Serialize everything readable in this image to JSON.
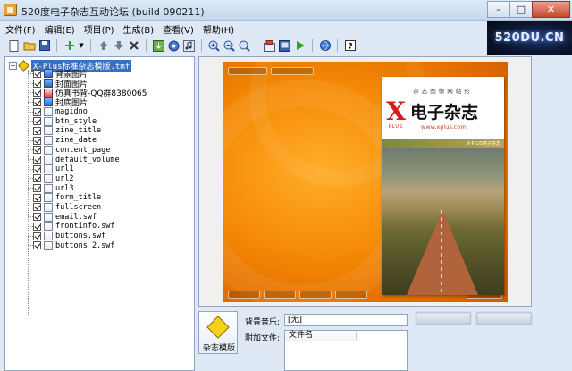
{
  "window": {
    "title": "520度电子杂志互动论坛 (build 090211)",
    "minimize": "–",
    "maximize": "□",
    "close": "✕"
  },
  "logo": {
    "text": "520DU.CN"
  },
  "menu": [
    "文件(F)",
    "编辑(E)",
    "项目(P)",
    "生成(B)",
    "查看(V)",
    "帮助(H)"
  ],
  "toolbar": {
    "icons": [
      "new-file-icon",
      "open-folder-icon",
      "save-icon",
      "add-icon",
      "move-up-icon",
      "move-down-icon",
      "delete-icon",
      "import-icon",
      "settings-icon",
      "music-icon",
      "zoom-in-icon",
      "zoom-out-icon",
      "zoom-reset-icon",
      "build-icon",
      "export-icon",
      "play-icon",
      "globe-icon",
      "help-icon"
    ]
  },
  "tree": {
    "root_label": "X-Plus标准杂志模版.tmf",
    "items": [
      {
        "label": "背景图片",
        "icon": "img"
      },
      {
        "label": "封面图片",
        "icon": "img"
      },
      {
        "label": "仿真书背-QQ群8380065",
        "icon": "img2"
      },
      {
        "label": "封底图片",
        "icon": "img"
      },
      {
        "label": "magidno",
        "icon": "doc"
      },
      {
        "label": "btn_style",
        "icon": "doc"
      },
      {
        "label": "zine_title",
        "icon": "doc"
      },
      {
        "label": "zine_date",
        "icon": "doc"
      },
      {
        "label": "content_page",
        "icon": "doc"
      },
      {
        "label": "default_volume",
        "icon": "doc"
      },
      {
        "label": "url1",
        "icon": "doc"
      },
      {
        "label": "url2",
        "icon": "doc"
      },
      {
        "label": "url3",
        "icon": "doc"
      },
      {
        "label": "form_title",
        "icon": "doc"
      },
      {
        "label": "fullscreen",
        "icon": "doc"
      },
      {
        "label": "email.swf",
        "icon": "doc"
      },
      {
        "label": "frontinfo.swf",
        "icon": "doc"
      },
      {
        "label": "buttons.swf",
        "icon": "doc"
      },
      {
        "label": "buttons_2.swf",
        "icon": "doc"
      }
    ]
  },
  "preview": {
    "cover_tagline": "杂志图像网站形",
    "cover_title": "电子杂志",
    "cover_url": "www.xplus.com",
    "cover_brand_x": "X",
    "cover_brand_plus": "PLUS",
    "cover_band": "X-PLUS电子杂志"
  },
  "bottom": {
    "template_label": "杂志模版",
    "music_label": "背景音乐:",
    "music_value": "[无]",
    "attach_label": "附加文件:",
    "attach_column": "文件名"
  }
}
